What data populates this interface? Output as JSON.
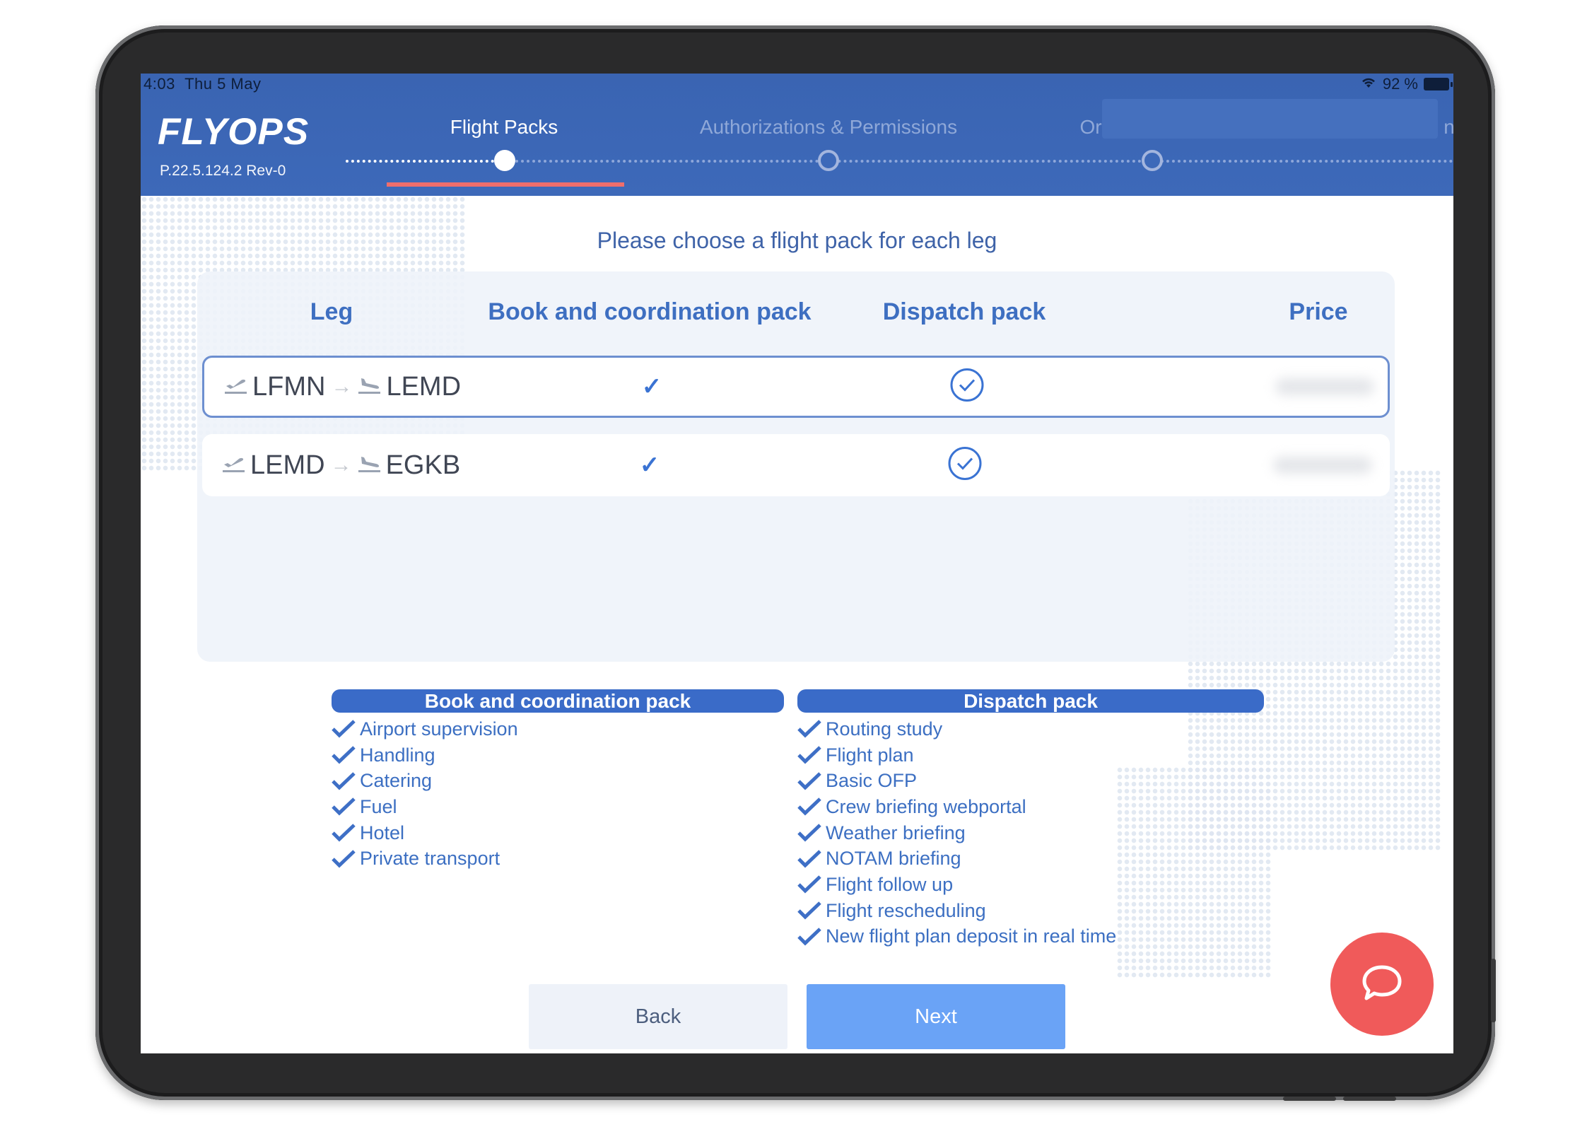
{
  "status_bar": {
    "time": "4:03",
    "date": "Thu 5 May",
    "wifi_icon": "wifi-icon",
    "battery_percent": "92 %"
  },
  "app": {
    "logo": "FLYOPS",
    "version": "P.22.5.124.2 Rev-0"
  },
  "steps": [
    {
      "label": "Flight Packs",
      "active": true
    },
    {
      "label": "Authorizations & Permissions",
      "active": false
    },
    {
      "label": "Or",
      "active": false
    }
  ],
  "main": {
    "title": "Please choose a flight pack for each leg",
    "columns": [
      "Leg",
      "Book and coordination pack",
      "Dispatch pack",
      "Price"
    ],
    "legs": [
      {
        "from": "LFMN",
        "to": "LEMD",
        "book_pack": true,
        "dispatch_pack": true,
        "selected": true
      },
      {
        "from": "LEMD",
        "to": "EGKB",
        "book_pack": true,
        "dispatch_pack": true,
        "selected": false
      }
    ]
  },
  "packs": {
    "book": {
      "title": "Book and coordination pack",
      "items": [
        "Airport supervision",
        "Handling",
        "Catering",
        "Fuel",
        "Hotel",
        "Private transport"
      ]
    },
    "dispatch": {
      "title": "Dispatch pack",
      "items": [
        "Routing study",
        "Flight plan",
        "Basic OFP",
        "Crew briefing webportal",
        "Weather briefing",
        "NOTAM briefing",
        "Flight follow up",
        "Flight rescheduling",
        "New flight plan deposit in real time"
      ]
    }
  },
  "buttons": {
    "back": "Back",
    "next": "Next"
  },
  "chat": {
    "icon": "chat-bubble-icon"
  },
  "colors": {
    "header": "#3d69b9",
    "accent": "#3a6bc8",
    "active_underline": "#ee6e6c",
    "next_button": "#6aa3f6",
    "chat_fab": "#f05a5a"
  }
}
